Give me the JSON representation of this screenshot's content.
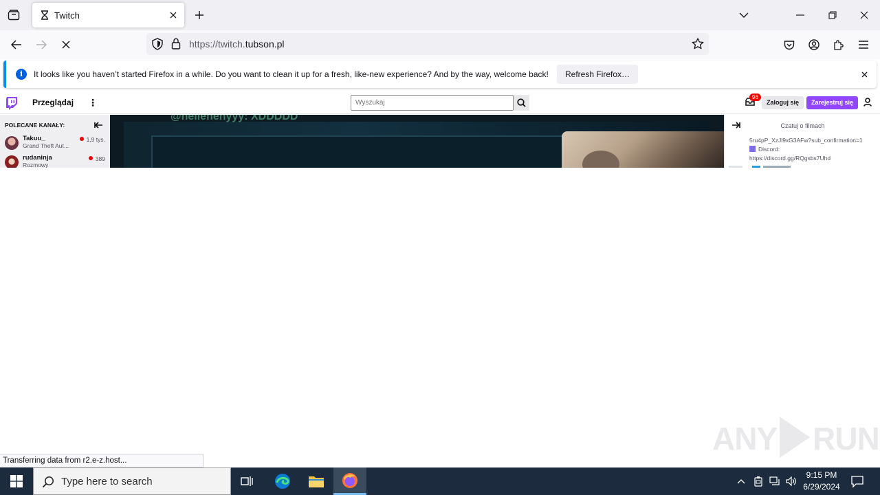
{
  "browser": {
    "tab": {
      "title": "Twitch"
    },
    "url": {
      "prefix": "https://twitch.",
      "domain": "tubson.pl"
    },
    "notification": {
      "message": "It looks like you haven’t started Firefox in a while. Do you want to clean it up for a fresh, like-new experience? And by the way, welcome back!",
      "button_label": "Refresh Firefox…"
    },
    "status_text": "Transferring data from r2.e-z.host..."
  },
  "twitch": {
    "browse_label": "Przeglądaj",
    "search_placeholder": "Wyszukaj",
    "notif_count": "96",
    "login_label": "Zaloguj się",
    "signup_label": "Zarejestruj się",
    "accent_color": "#9147ff",
    "sidebar": {
      "header": "POLECANE KANAŁY:",
      "channels": [
        {
          "name": "Takuu_",
          "category": "Grand Theft Aut...",
          "viewers": "1,9 tys."
        },
        {
          "name": "rudaninja",
          "category": "Rozmowy",
          "viewers": "389"
        }
      ]
    },
    "player": {
      "overlay_text": "@hellehehyyy: XDDDDD"
    },
    "chat": {
      "title": "Czatuj o filmach",
      "lines": [
        "5ru4pP_XzJl9xG3AFw?sub_confirmation=1",
        "Discord:",
        "https://discord.gg/RQgsbs7Uhd"
      ]
    }
  },
  "watermark": {
    "text_left": "ANY",
    "text_right": "RUN"
  },
  "taskbar": {
    "search_placeholder": "Type here to search",
    "time": "9:15 PM",
    "date": "6/29/2024"
  }
}
